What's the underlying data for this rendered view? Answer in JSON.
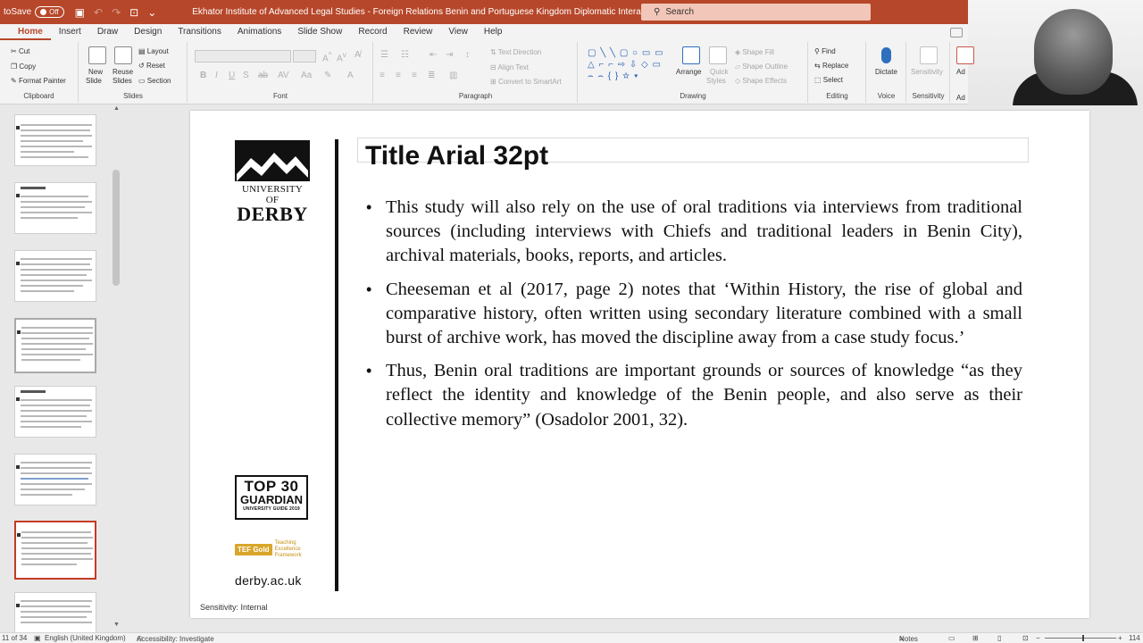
{
  "titlebar": {
    "autosave_label": "toSave",
    "autosave_state": "Off",
    "title": "Ekhator Institute of Advanced Legal Studies - Foreign Relations Benin and Portuguese Kingdom Diplomatic Interact... • Saved to this PC",
    "search_placeholder": "Search",
    "accent_color": "#b7472a"
  },
  "tabs": [
    "Home",
    "Insert",
    "Draw",
    "Design",
    "Transitions",
    "Animations",
    "Slide Show",
    "Record",
    "Review",
    "View",
    "Help"
  ],
  "active_tab": "Home",
  "ribbon": {
    "clipboard": {
      "cut": "Cut",
      "copy": "Copy",
      "format_painter": "Format Painter",
      "label": "Clipboard"
    },
    "slides": {
      "new_slide": "New",
      "new_slide2": "Slide",
      "reuse": "Reuse",
      "reuse2": "Slides",
      "layout": "Layout",
      "reset": "Reset",
      "section": "Section",
      "label": "Slides"
    },
    "font": {
      "label": "Font"
    },
    "paragraph": {
      "text_direction": "Text Direction",
      "align_text": "Align Text",
      "convert_smartart": "Convert to SmartArt",
      "label": "Paragraph"
    },
    "drawing": {
      "arrange": "Arrange",
      "quick_styles": "Quick",
      "quick_styles2": "Styles",
      "shape_fill": "Shape Fill",
      "shape_outline": "Shape Outline",
      "shape_effects": "Shape Effects",
      "label": "Drawing"
    },
    "editing": {
      "find": "Find",
      "replace": "Replace",
      "select": "Select",
      "label": "Editing"
    },
    "voice": {
      "dictate": "Dictate",
      "label": "Voice"
    },
    "sensitivity": {
      "sensitivity": "Sensitivity",
      "label": "Sensitivity"
    },
    "addins": {
      "label": "Ad",
      "button": "Ad"
    }
  },
  "slide": {
    "logo_line1": "UNIVERSITY OF",
    "logo_line2": "DERBY",
    "title": "Title Arial 32pt",
    "bullets": [
      "This study will also rely on the use of oral traditions via interviews from traditional sources (including interviews with Chiefs and traditional leaders in Benin City), archival materials, books, reports, and articles.",
      "Cheeseman et al (2017, page 2) notes that ‘Within History, the rise of global and comparative history, often written using secondary literature combined with a small burst of archive work, has moved the discipline away from a case study focus.’",
      "Thus, Benin oral traditions are important grounds or sources of knowledge “as they reflect the identity and knowledge of the Benin people, and also serve as their collective memory” (Osadolor 2001, 32)."
    ],
    "badge_top": "TOP 30",
    "badge_mid": "GUARDIAN",
    "badge_small": "UNIVERSITY GUIDE 2019",
    "tef_badge": "TEF Gold",
    "tef_text": "Teaching Excellence Framework",
    "website": "derby.ac.uk",
    "sensitivity": "Sensitivity: Internal"
  },
  "statusbar": {
    "slide_count": "11 of 34",
    "language": "English (United Kingdom)",
    "accessibility": "Accessibility: Investigate",
    "notes": "Notes",
    "zoom": "114"
  }
}
